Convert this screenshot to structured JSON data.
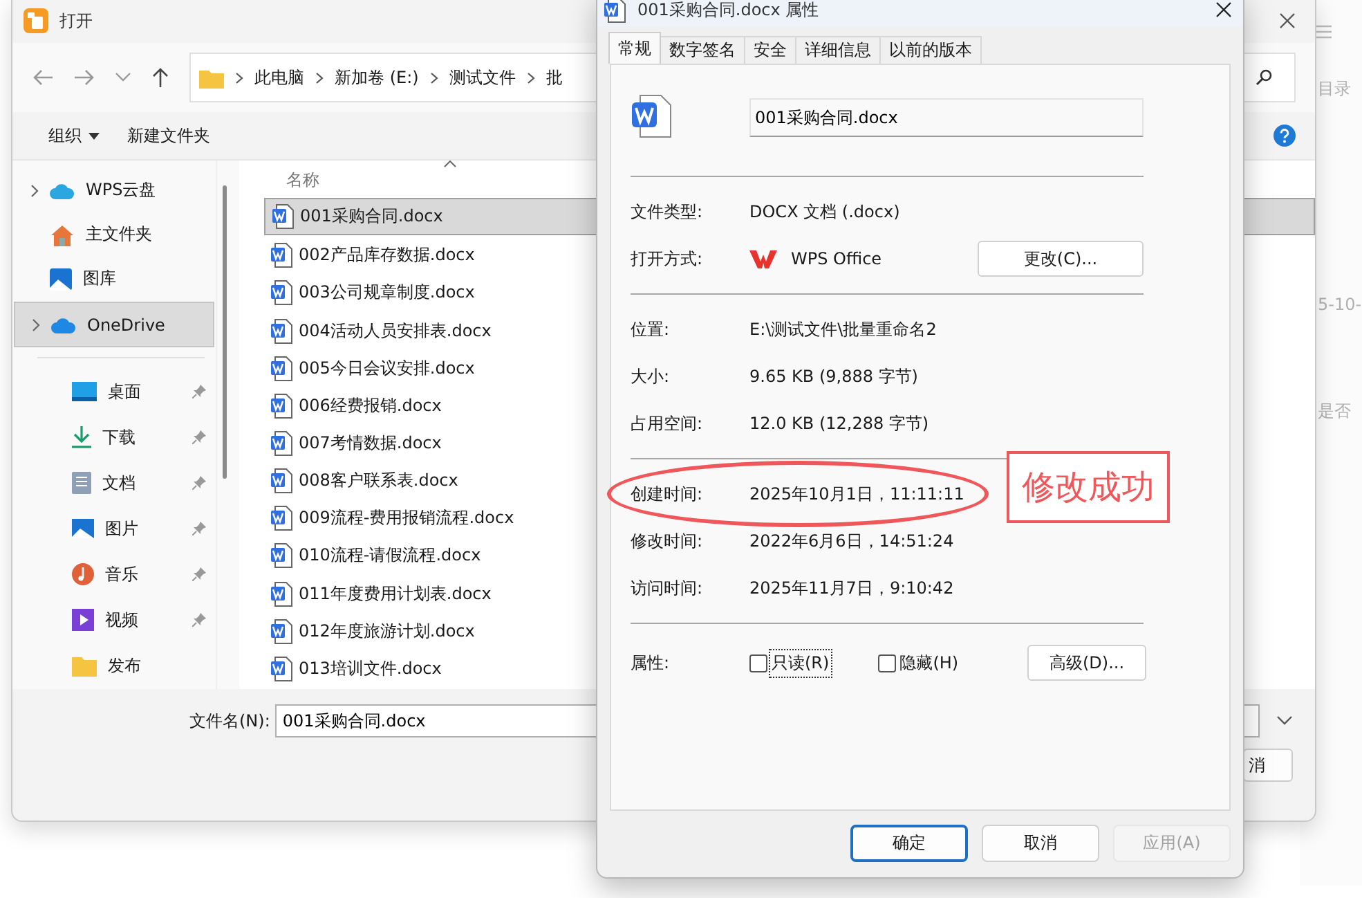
{
  "open_dialog": {
    "title": "打开",
    "breadcrumbs": [
      "此电脑",
      "新加卷 (E:)",
      "测试文件",
      "批"
    ],
    "toolbar": {
      "organize": "组织",
      "new_folder": "新建文件夹"
    },
    "sidebar": {
      "locations": [
        {
          "label": "WPS云盘",
          "expandable": true,
          "selected": false
        },
        {
          "label": "主文件夹",
          "expandable": false,
          "selected": false
        },
        {
          "label": "图库",
          "expandable": false,
          "selected": false
        },
        {
          "label": "OneDrive",
          "expandable": true,
          "selected": true
        }
      ],
      "quick_access": [
        {
          "label": "桌面",
          "pinned": true
        },
        {
          "label": "下载",
          "pinned": true
        },
        {
          "label": "文档",
          "pinned": true
        },
        {
          "label": "图片",
          "pinned": true
        },
        {
          "label": "音乐",
          "pinned": true
        },
        {
          "label": "视频",
          "pinned": true
        },
        {
          "label": "发布",
          "pinned": false
        }
      ]
    },
    "column_header": "名称",
    "files": [
      {
        "name": "001采购合同.docx",
        "selected": true
      },
      {
        "name": "002产品库存数据.docx",
        "selected": false
      },
      {
        "name": "003公司规章制度.docx",
        "selected": false
      },
      {
        "name": "004活动人员安排表.docx",
        "selected": false
      },
      {
        "name": "005今日会议安排.docx",
        "selected": false
      },
      {
        "name": "006经费报销.docx",
        "selected": false
      },
      {
        "name": "007考情数据.docx",
        "selected": false
      },
      {
        "name": "008客户联系表.docx",
        "selected": false
      },
      {
        "name": "009流程-费用报销流程.docx",
        "selected": false
      },
      {
        "name": "010流程-请假流程.docx",
        "selected": false
      },
      {
        "name": "011年度费用计划表.docx",
        "selected": false
      },
      {
        "name": "012年度旅游计划.docx",
        "selected": false
      },
      {
        "name": "013培训文件.docx",
        "selected": false
      }
    ],
    "filename_label": "文件名(N):",
    "filename_value": "001采购合同.docx",
    "button_fragment": "消"
  },
  "background_window": {
    "texts": [
      "目录",
      "5-10-",
      "是否"
    ]
  },
  "properties": {
    "title": "001采购合同.docx 属性",
    "tabs": [
      {
        "label": "常规",
        "selected": true
      },
      {
        "label": "数字签名",
        "selected": false
      },
      {
        "label": "安全",
        "selected": false
      },
      {
        "label": "详细信息",
        "selected": false
      },
      {
        "label": "以前的版本",
        "selected": false
      }
    ],
    "filename": "001采购合同.docx",
    "groups": [
      [
        {
          "kind": "text",
          "label": "文件类型:",
          "value": "DOCX 文档 (.docx)"
        },
        {
          "kind": "app",
          "label": "打开方式:",
          "value": "WPS Office",
          "button": "更改(C)..."
        }
      ],
      [
        {
          "kind": "text",
          "label": "位置:",
          "value": "E:\\测试文件\\批量重命名2"
        },
        {
          "kind": "text",
          "label": "大小:",
          "value": "9.65 KB (9,888 字节)"
        },
        {
          "kind": "text",
          "label": "占用空间:",
          "value": "12.0 KB (12,288 字节)"
        }
      ],
      [
        {
          "kind": "text",
          "label": "创建时间:",
          "value": "2025年10月1日，11:11:11",
          "circled": true
        },
        {
          "kind": "text",
          "label": "修改时间:",
          "value": "2022年6月6日，14:51:24",
          "circled": false
        },
        {
          "kind": "text",
          "label": "访问时间:",
          "value": "2025年11月7日，9:10:42",
          "circled": false
        }
      ]
    ],
    "attributes": {
      "label": "属性:",
      "options": [
        {
          "label": "只读(R)",
          "checked": false,
          "focused": true
        },
        {
          "label": "隐藏(H)",
          "checked": false,
          "focused": false
        }
      ],
      "advanced": "高级(D)..."
    },
    "buttons": [
      {
        "label": "确定",
        "default": true,
        "disabled": false
      },
      {
        "label": "取消",
        "default": false,
        "disabled": false
      },
      {
        "label": "应用(A)",
        "default": false,
        "disabled": true
      }
    ]
  },
  "annotation": {
    "text": "修改成功"
  }
}
